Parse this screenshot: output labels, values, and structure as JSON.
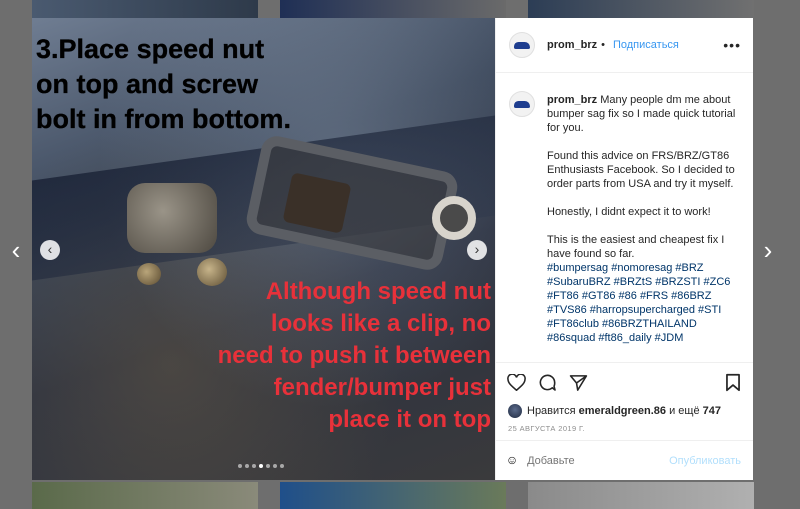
{
  "post": {
    "title": "3.Place speed nut on top and screw bolt in from bottom.",
    "caption": "Although speed nut looks like a clip, no need to push it between fender/bumper just place it on top",
    "carousel": {
      "count": 7,
      "active_index": 3
    }
  },
  "header": {
    "username": "prom_brz",
    "follow_label": "Подписаться",
    "more_label": "•••"
  },
  "comment": {
    "username": "prom_brz",
    "paragraphs": [
      "Many people dm me about bumper sag fix so I made quick tutorial for you.",
      "Found this advice on FRS/BRZ/GT86 Enthusiasts Facebook. So I decided to order parts from USA and try it myself.",
      "Honestly, I didnt expect it to work!",
      "This is the easiest and cheapest fix I have found so far."
    ],
    "hashtags": "#bumpersag #nomoresag #BRZ #SubaruBRZ #BRZtS #BRZSTI #ZC6 #FT86 #GT86 #86 #FRS #86BRZ #TVS86 #harropsupercharged #STI #FT86club #86BRZTHAILAND #86squad #ft86_daily #JDM"
  },
  "likes": {
    "prefix": "Нравится",
    "user": "emeraldgreen.86",
    "and": "и ещё",
    "count": "747"
  },
  "date": "25 АВГУСТА 2019 Г.",
  "add_comment": {
    "placeholder": "Добавьте",
    "publish_label": "Опубликовать"
  },
  "nav": {
    "prev": "‹",
    "next": "›"
  },
  "icons": [
    "heart-icon",
    "comment-icon",
    "share-icon",
    "bookmark-icon",
    "smile-icon"
  ],
  "colors": {
    "link": "#3897f0",
    "caption_red": "#e8313a",
    "hashtag": "#003569"
  }
}
